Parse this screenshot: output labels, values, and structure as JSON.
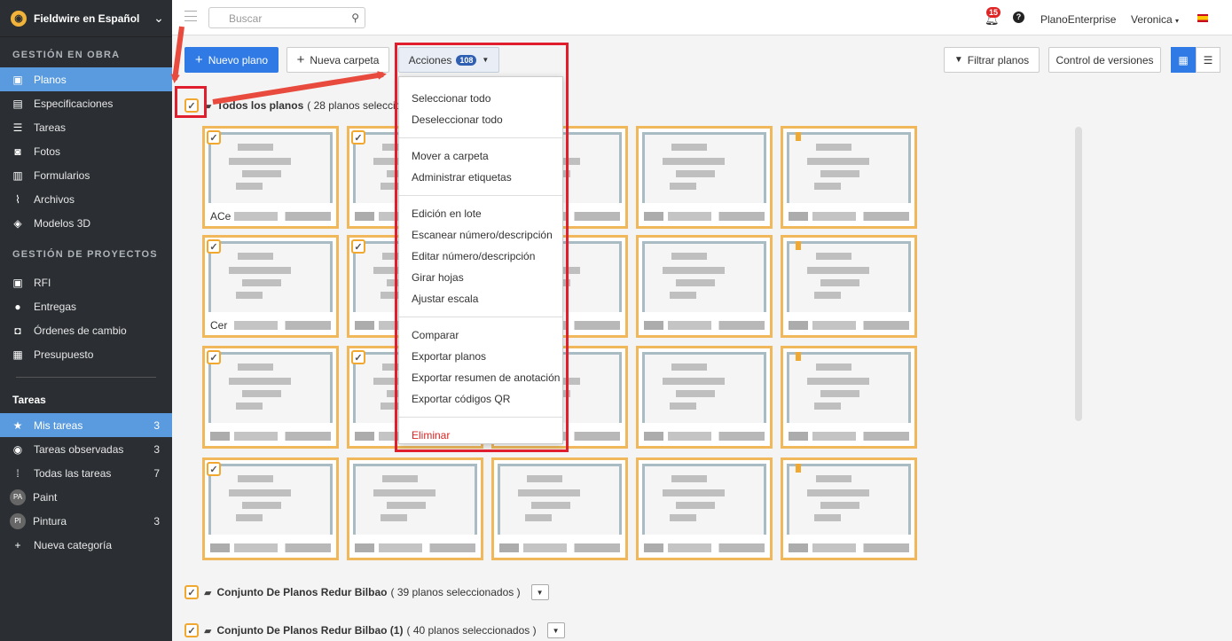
{
  "sidebar": {
    "brand": "Fieldwire en Español",
    "section_obra": "GESTIÓN EN OBRA",
    "obra_items": [
      {
        "label": "Planos",
        "icon": "plans-icon",
        "active": true
      },
      {
        "label": "Especificaciones",
        "icon": "specs-icon"
      },
      {
        "label": "Tareas",
        "icon": "list-icon"
      },
      {
        "label": "Fotos",
        "icon": "camera-icon"
      },
      {
        "label": "Formularios",
        "icon": "forms-icon"
      },
      {
        "label": "Archivos",
        "icon": "paperclip-icon"
      },
      {
        "label": "Modelos 3D",
        "icon": "cube-icon"
      }
    ],
    "section_proyectos": "GESTIÓN DE PROYECTOS",
    "proyecto_items": [
      {
        "label": "RFI",
        "icon": "rfi-icon"
      },
      {
        "label": "Entregas",
        "icon": "person-icon"
      },
      {
        "label": "Órdenes de cambio",
        "icon": "change-order-icon"
      },
      {
        "label": "Presupuesto",
        "icon": "calculator-icon"
      }
    ],
    "tareas_title": "Tareas",
    "tareas_items": [
      {
        "label": "Mis tareas",
        "icon": "star-icon",
        "count": "3",
        "active": true
      },
      {
        "label": "Tareas observadas",
        "icon": "eye-icon",
        "count": "3"
      },
      {
        "label": "Todas las tareas",
        "icon": "grid-icon",
        "count": "7"
      },
      {
        "label": "Paint",
        "badge": "PA",
        "count": ""
      },
      {
        "label": "Pintura",
        "badge": "PI",
        "count": "3"
      },
      {
        "label": "Nueva categoría",
        "icon": "plus-icon",
        "count": ""
      }
    ]
  },
  "topbar": {
    "search_placeholder": "Buscar",
    "notifications": "15",
    "help": "?",
    "plan": "PlanoEnterprise",
    "user": "Veronica"
  },
  "toolbar": {
    "new_plan": "Nuevo plano",
    "new_folder": "Nueva carpeta",
    "actions": "Acciones",
    "actions_count": "108",
    "filter": "Filtrar planos",
    "versions": "Control de versiones"
  },
  "content": {
    "all_plans": "Todos los planos",
    "all_plans_sel": "( 28 planos selecciona",
    "thumb_labels": [
      "ACe",
      "Cer",
      "",
      ""
    ],
    "folder2": "Conjunto De Planos Redur Bilbao",
    "folder2_sel": "( 39 planos seleccionados )",
    "folder3": "Conjunto De Planos Redur Bilbao (1)",
    "folder3_sel": "( 40 planos seleccionados )"
  },
  "actions_menu": {
    "group1": [
      "Seleccionar todo",
      "Deseleccionar todo"
    ],
    "group2": [
      "Mover a carpeta",
      "Administrar etiquetas"
    ],
    "group3": [
      "Edición en lote",
      "Escanear número/descripción",
      "Editar número/descripción",
      "Girar hojas",
      "Ajustar escala"
    ],
    "group4": [
      "Comparar",
      "Exportar planos",
      "Exportar resumen de anotación",
      "Exportar códigos QR"
    ],
    "danger": "Eliminar"
  }
}
